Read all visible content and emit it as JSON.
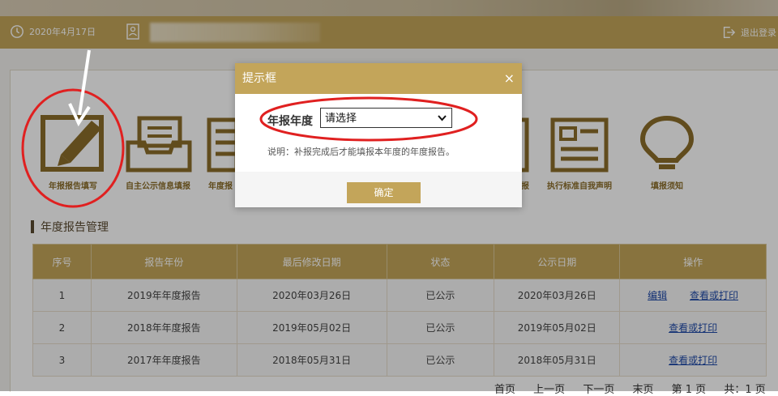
{
  "header": {
    "date": "2020年4月17日",
    "logout_label": "退出登录"
  },
  "toolbar": {
    "items": [
      {
        "label": "年报报告填写"
      },
      {
        "label": "自主公示信息填报"
      },
      {
        "label": "年度报"
      },
      {
        "label": "填报"
      },
      {
        "label": "执行标准自我声明"
      },
      {
        "label": "填报须知"
      }
    ]
  },
  "section": {
    "title": "年度报告管理"
  },
  "table": {
    "headers": [
      "序号",
      "报告年份",
      "最后修改日期",
      "状态",
      "公示日期",
      "操作"
    ],
    "rows": [
      {
        "no": "1",
        "year": "2019年年度报告",
        "modified": "2020年03月26日",
        "status": "已公示",
        "published": "2020年03月26日",
        "edit": "编辑",
        "view": "查看或打印"
      },
      {
        "no": "2",
        "year": "2018年年度报告",
        "modified": "2019年05月02日",
        "status": "已公示",
        "published": "2019年05月02日",
        "view": "查看或打印"
      },
      {
        "no": "3",
        "year": "2017年年度报告",
        "modified": "2018年05月31日",
        "status": "已公示",
        "published": "2018年05月31日",
        "view": "查看或打印"
      }
    ]
  },
  "pager": {
    "first": "首页",
    "prev": "上一页",
    "next": "下一页",
    "last": "末页",
    "current": "第 1 页",
    "total": "共：1 页"
  },
  "dialog": {
    "title": "提示框",
    "close": "×",
    "field_label": "年报年度",
    "select_value": "请选择",
    "note": "说明：补报完成后才能填报本年度的年度报告。",
    "ok_label": "确定"
  },
  "colors": {
    "accent": "#c3a55a",
    "icon": "#8b6d2a",
    "link": "#1f49a8",
    "annotation": "#e02020"
  }
}
